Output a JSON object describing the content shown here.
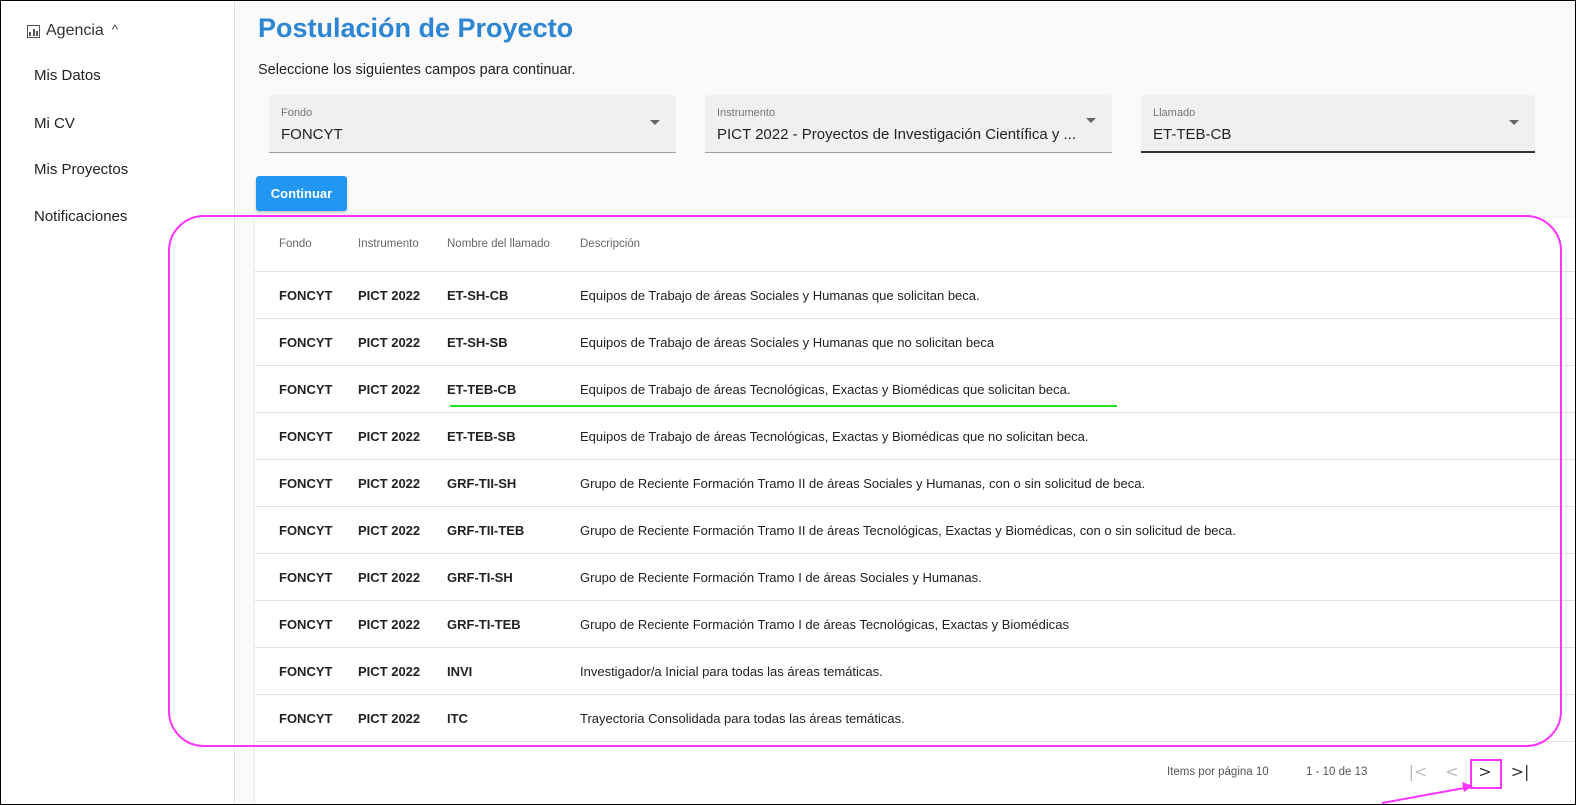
{
  "sidebar": {
    "section_label": "Agencia",
    "items": [
      {
        "label": "Mis Datos"
      },
      {
        "label": "Mi CV"
      },
      {
        "label": "Mis Proyectos"
      },
      {
        "label": "Notificaciones"
      }
    ]
  },
  "main": {
    "title": "Postulación de Proyecto",
    "subtitle": "Seleccione los siguientes campos para continuar.",
    "selects": {
      "fondo": {
        "label": "Fondo",
        "value": "FONCYT"
      },
      "instrumento": {
        "label": "Instrumento",
        "value": "PICT 2022 - Proyectos de Investigación Científica y ..."
      },
      "llamado": {
        "label": "Llamado",
        "value": "ET-TEB-CB"
      }
    },
    "continue_label": "Continuar"
  },
  "table": {
    "headers": {
      "fondo": "Fondo",
      "instrumento": "Instrumento",
      "nombre": "Nombre del llamado",
      "descripcion": "Descripción"
    },
    "rows": [
      {
        "fondo": "FONCYT",
        "instrumento": "PICT 2022",
        "nombre": "ET-SH-CB",
        "descripcion": "Equipos de Trabajo de áreas Sociales y Humanas que solicitan beca."
      },
      {
        "fondo": "FONCYT",
        "instrumento": "PICT 2022",
        "nombre": "ET-SH-SB",
        "descripcion": "Equipos de Trabajo de áreas Sociales y Humanas que no solicitan beca"
      },
      {
        "fondo": "FONCYT",
        "instrumento": "PICT 2022",
        "nombre": "ET-TEB-CB",
        "descripcion": "Equipos de Trabajo de áreas Tecnológicas, Exactas y Biomédicas que solicitan beca."
      },
      {
        "fondo": "FONCYT",
        "instrumento": "PICT 2022",
        "nombre": "ET-TEB-SB",
        "descripcion": "Equipos de Trabajo de áreas Tecnológicas, Exactas y Biomédicas que no solicitan beca."
      },
      {
        "fondo": "FONCYT",
        "instrumento": "PICT 2022",
        "nombre": "GRF-TII-SH",
        "descripcion": "Grupo de Reciente Formación Tramo II de áreas Sociales y Humanas, con o sin solicitud de beca."
      },
      {
        "fondo": "FONCYT",
        "instrumento": "PICT 2022",
        "nombre": "GRF-TII-TEB",
        "descripcion": "Grupo de Reciente Formación Tramo II de áreas Tecnológicas, Exactas y Biomédicas, con o sin solicitud de beca."
      },
      {
        "fondo": "FONCYT",
        "instrumento": "PICT 2022",
        "nombre": "GRF-TI-SH",
        "descripcion": "Grupo de Reciente Formación Tramo I de áreas Sociales y Humanas."
      },
      {
        "fondo": "FONCYT",
        "instrumento": "PICT 2022",
        "nombre": "GRF-TI-TEB",
        "descripcion": "Grupo de Reciente Formación Tramo I de áreas Tecnológicas, Exactas y Biomédicas"
      },
      {
        "fondo": "FONCYT",
        "instrumento": "PICT 2022",
        "nombre": "INVI",
        "descripcion": "Investigador/a Inicial para todas las áreas temáticas."
      },
      {
        "fondo": "FONCYT",
        "instrumento": "PICT 2022",
        "nombre": "ITC",
        "descripcion": "Trayectoria Consolidada para todas las áreas temáticas."
      }
    ]
  },
  "paginator": {
    "items_per_page_label": "Items por página",
    "items_per_page": "10",
    "range": "1 - 10 de 13",
    "first_icon": "first-page-icon",
    "prev_icon": "chevron-left-icon",
    "next_icon": "chevron-right-icon",
    "last_icon": "last-page-icon"
  },
  "colors": {
    "title": "#2c86d4",
    "button": "#2196f3",
    "annotation_magenta": "#ff33ff",
    "annotation_green": "#22e022"
  }
}
